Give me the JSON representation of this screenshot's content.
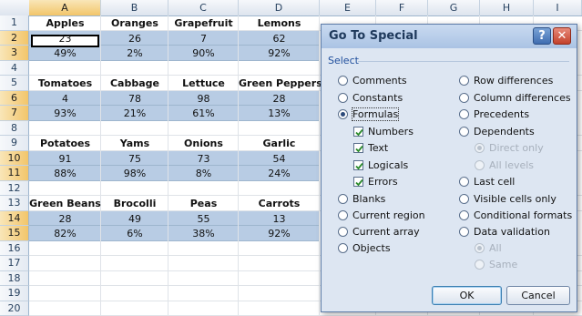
{
  "sheet": {
    "columns": [
      "A",
      "B",
      "C",
      "D",
      "E",
      "F",
      "G",
      "H",
      "I"
    ],
    "rows": [
      "1",
      "2",
      "3",
      "4",
      "5",
      "6",
      "7",
      "8",
      "9",
      "10",
      "11",
      "12",
      "13",
      "14",
      "15",
      "16",
      "17",
      "18",
      "19",
      "20"
    ],
    "cells": {
      "r1": [
        "Apples",
        "Oranges",
        "Grapefruit",
        "Lemons"
      ],
      "r2": [
        "23",
        "26",
        "7",
        "62"
      ],
      "r3": [
        "49%",
        "2%",
        "90%",
        "92%"
      ],
      "r5": [
        "Tomatoes",
        "Cabbage",
        "Lettuce",
        "Green Peppers"
      ],
      "r6": [
        "4",
        "78",
        "98",
        "28"
      ],
      "r7": [
        "93%",
        "21%",
        "61%",
        "13%"
      ],
      "r9": [
        "Potatoes",
        "Yams",
        "Onions",
        "Garlic"
      ],
      "r10": [
        "91",
        "75",
        "73",
        "54"
      ],
      "r11": [
        "88%",
        "98%",
        "8%",
        "24%"
      ],
      "r13": [
        "Green Beans",
        "Brocolli",
        "Peas",
        "Carrots"
      ],
      "r14": [
        "28",
        "49",
        "55",
        "13"
      ],
      "r15": [
        "82%",
        "6%",
        "38%",
        "92%"
      ]
    },
    "highlight_color": "#b8cce4"
  },
  "dialog": {
    "title": "Go To Special",
    "help_glyph": "?",
    "close_glyph": "✕",
    "group_label": "Select",
    "left_options": {
      "comments": "Comments",
      "constants": "Constants",
      "formulas": "Formulas",
      "numbers": "Numbers",
      "text": "Text",
      "logicals": "Logicals",
      "errors": "Errors",
      "blanks": "Blanks",
      "current_region": "Current region",
      "current_array": "Current array",
      "objects": "Objects"
    },
    "right_options": {
      "row_differences": "Row differences",
      "column_differences": "Column differences",
      "precedents": "Precedents",
      "dependents": "Dependents",
      "direct_only": "Direct only",
      "all_levels": "All levels",
      "last_cell": "Last cell",
      "visible_cells_only": "Visible cells only",
      "conditional_formats": "Conditional formats",
      "data_validation": "Data validation",
      "all": "All",
      "same": "Same"
    },
    "ok_label": "OK",
    "cancel_label": "Cancel"
  }
}
